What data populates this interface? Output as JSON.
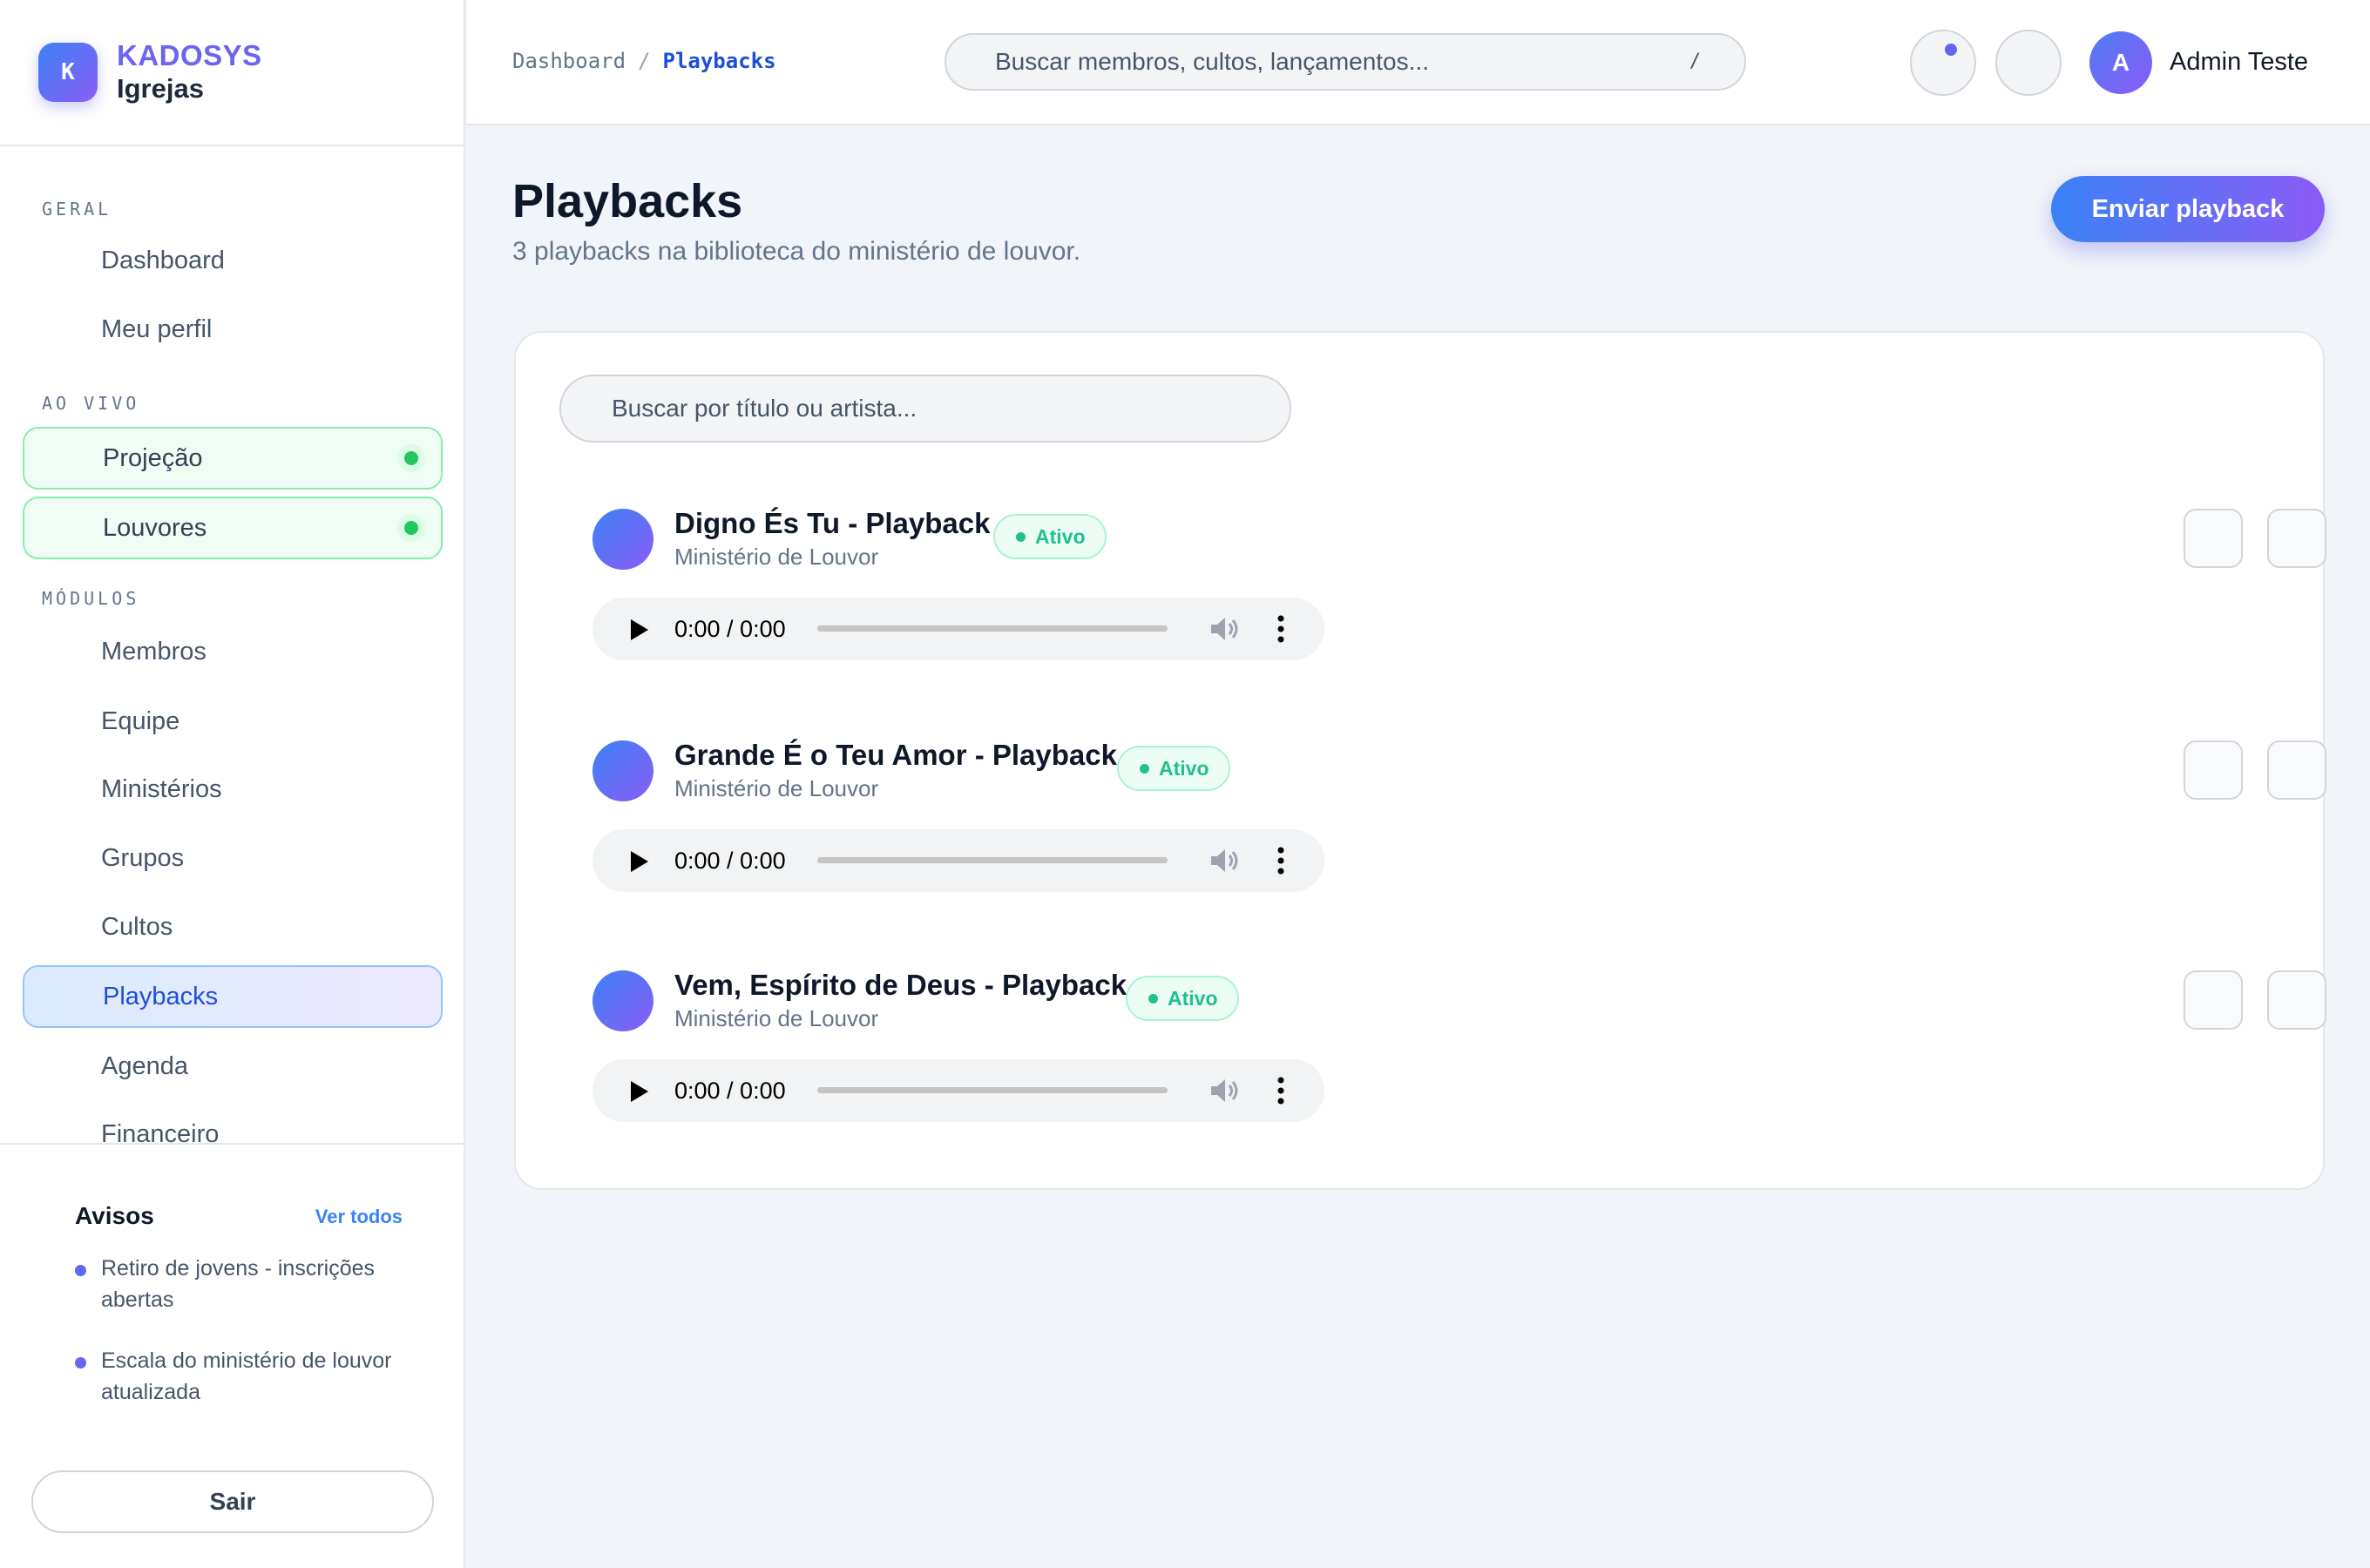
{
  "brand": {
    "logo_letter": "K",
    "name": "KADOSYS",
    "subtitle": "Igrejas"
  },
  "sidebar": {
    "sections": [
      {
        "label": "GERAL",
        "items": [
          {
            "label": "Dashboard"
          },
          {
            "label": "Meu perfil"
          }
        ]
      },
      {
        "label": "AO VIVO",
        "items": [
          {
            "label": "Projeção",
            "live": true
          },
          {
            "label": "Louvores",
            "live": true
          }
        ]
      },
      {
        "label": "MÓDULOS",
        "items": [
          {
            "label": "Membros"
          },
          {
            "label": "Equipe"
          },
          {
            "label": "Ministérios"
          },
          {
            "label": "Grupos"
          },
          {
            "label": "Cultos"
          },
          {
            "label": "Playbacks",
            "active": true
          },
          {
            "label": "Agenda"
          },
          {
            "label": "Financeiro"
          }
        ]
      }
    ],
    "avisos": {
      "title": "Avisos",
      "link": "Ver todos",
      "items": [
        "Retiro de jovens - inscrições abertas",
        "Escala do ministério de louvor atualizada"
      ]
    },
    "logout_label": "Sair"
  },
  "header": {
    "breadcrumb": {
      "root": "Dashboard",
      "separator": "/",
      "current": "Playbacks"
    },
    "search": {
      "placeholder": "Buscar membros, cultos, lançamentos...",
      "shortcut": "/"
    },
    "user": {
      "initial": "A",
      "name": "Admin Teste"
    }
  },
  "main": {
    "title": "Playbacks",
    "subtitle": "3 playbacks na biblioteca do ministério de louvor.",
    "primary_button": "Enviar playback",
    "search_placeholder": "Buscar por título ou artista...",
    "playbacks": [
      {
        "title": "Digno És Tu - Playback",
        "artist": "Ministério de Louvor",
        "status": "Ativo",
        "time": "0:00 / 0:00"
      },
      {
        "title": "Grande É o Teu Amor - Playback",
        "artist": "Ministério de Louvor",
        "status": "Ativo",
        "time": "0:00 / 0:00"
      },
      {
        "title": "Vem, Espírito de Deus - Playback",
        "artist": "Ministério de Louvor",
        "status": "Ativo",
        "time": "0:00 / 0:00"
      }
    ]
  },
  "colors": {
    "accent_blue": "#3b82f6",
    "accent_violet": "#8b5cf6",
    "status_green": "#22c08a",
    "live_green": "#22c55e"
  }
}
